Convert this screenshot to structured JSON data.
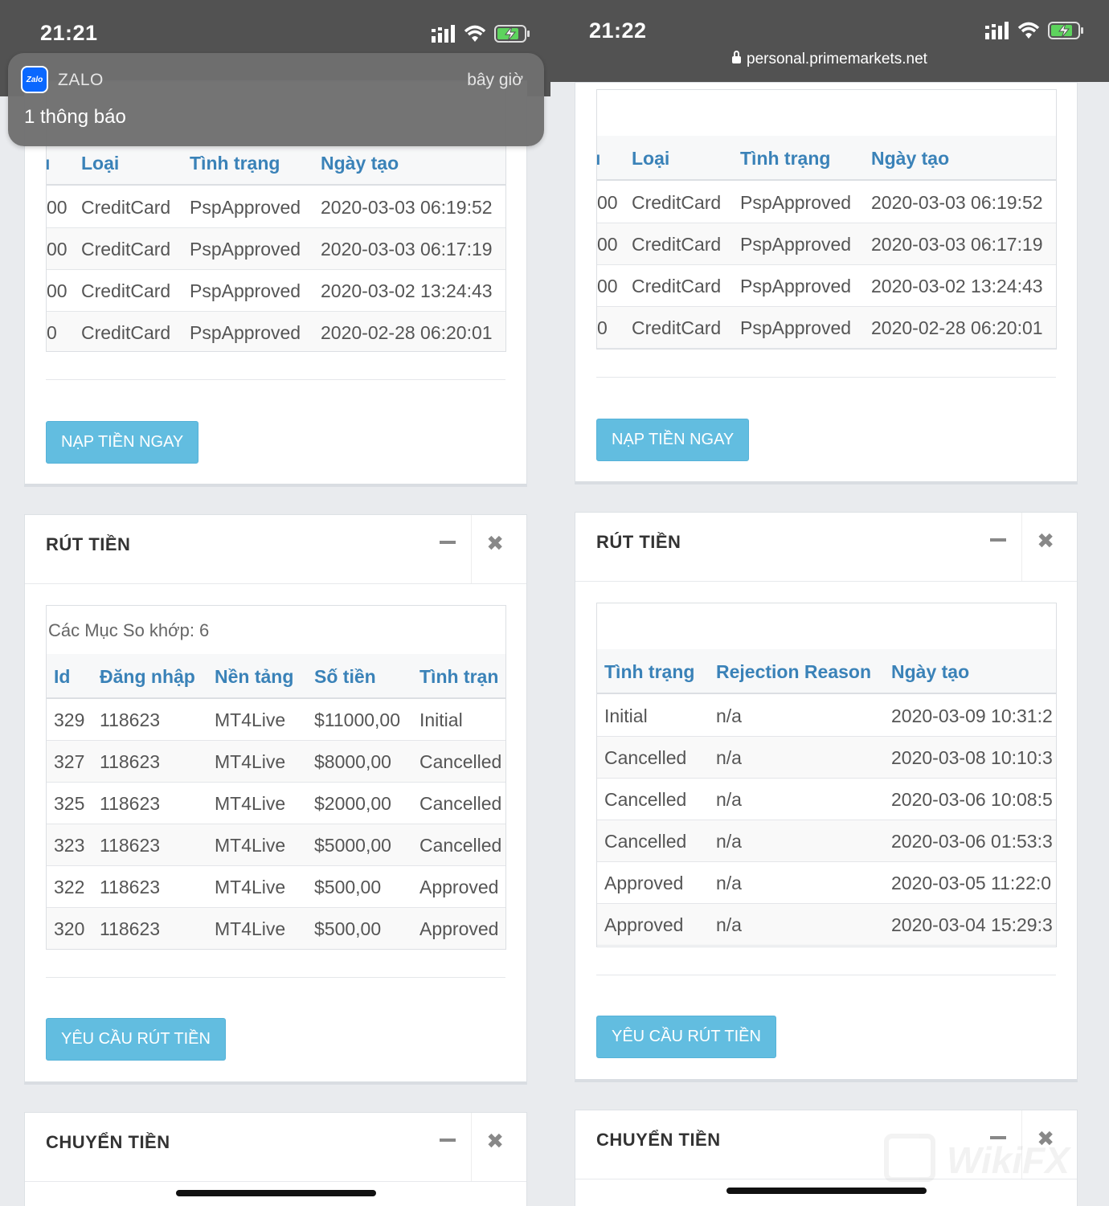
{
  "left": {
    "time": "21:21",
    "notification": {
      "app_icon_text": "Zalo",
      "app": "ZALO",
      "time": "bây giờ",
      "message": "1 thông báo"
    },
    "deposit_table": {
      "headers": [
        "ı",
        "Loại",
        "Tình trạng",
        "Ngày tạo"
      ],
      "rows": [
        [
          "00",
          "CreditCard",
          "PspApproved",
          "2020-03-03 06:19:52"
        ],
        [
          "00",
          "CreditCard",
          "PspApproved",
          "2020-03-03 06:17:19"
        ],
        [
          "00",
          "CreditCard",
          "PspApproved",
          "2020-03-02 13:24:43"
        ],
        [
          "0",
          "CreditCard",
          "PspApproved",
          "2020-02-28 06:20:01"
        ]
      ]
    },
    "deposit_button": "NẠP TIỀN NGAY",
    "withdraw": {
      "title": "RÚT TIỀN",
      "caption": "Các Mục So khớp: 6",
      "headers": [
        "Id",
        "Đăng nhập",
        "Nền tảng",
        "Số tiền",
        "Tình trạn"
      ],
      "rows": [
        [
          "329",
          "118623",
          "MT4Live",
          "$11000,00",
          "Initial"
        ],
        [
          "327",
          "118623",
          "MT4Live",
          "$8000,00",
          "Cancelled"
        ],
        [
          "325",
          "118623",
          "MT4Live",
          "$2000,00",
          "Cancelled"
        ],
        [
          "323",
          "118623",
          "MT4Live",
          "$5000,00",
          "Cancelled"
        ],
        [
          "322",
          "118623",
          "MT4Live",
          "$500,00",
          "Approved"
        ],
        [
          "320",
          "118623",
          "MT4Live",
          "$500,00",
          "Approved"
        ]
      ],
      "button": "YÊU CẦU RÚT TIỀN"
    },
    "transfer_title": "CHUYỂN TIỀN"
  },
  "right": {
    "time": "21:22",
    "url": "personal.primemarkets.net",
    "deposit_table": {
      "headers": [
        "ı",
        "Loại",
        "Tình trạng",
        "Ngày tạo"
      ],
      "rows": [
        [
          "00",
          "CreditCard",
          "PspApproved",
          "2020-03-03 06:19:52"
        ],
        [
          "00",
          "CreditCard",
          "PspApproved",
          "2020-03-03 06:17:19"
        ],
        [
          "00",
          "CreditCard",
          "PspApproved",
          "2020-03-02 13:24:43"
        ],
        [
          "0",
          "CreditCard",
          "PspApproved",
          "2020-02-28 06:20:01"
        ]
      ]
    },
    "deposit_button": "NẠP TIỀN NGAY",
    "withdraw": {
      "title": "RÚT TIỀN",
      "headers": [
        "Tình trạng",
        "Rejection Reason",
        "Ngày tạo"
      ],
      "rows": [
        [
          "Initial",
          "n/a",
          "2020-03-09 10:31:2"
        ],
        [
          "Cancelled",
          "n/a",
          "2020-03-08 10:10:3"
        ],
        [
          "Cancelled",
          "n/a",
          "2020-03-06 10:08:5"
        ],
        [
          "Cancelled",
          "n/a",
          "2020-03-06 01:53:3"
        ],
        [
          "Approved",
          "n/a",
          "2020-03-05 11:22:0"
        ],
        [
          "Approved",
          "n/a",
          "2020-03-04 15:29:3"
        ]
      ],
      "button": "YÊU CẦU RÚT TIỀN"
    },
    "transfer_title": "CHUYỂN TIỀN"
  },
  "icons": {
    "minimize": "minus-icon",
    "close": "close-icon",
    "close_glyph": "✖",
    "signal": "signal-icon",
    "wifi": "wifi-icon",
    "battery": "battery-charging-icon",
    "lock": "lock-icon"
  },
  "colors": {
    "header_text": "#3a82b8",
    "button": "#62bde0",
    "status_bar": "#525252",
    "battery": "#5dd35d"
  }
}
